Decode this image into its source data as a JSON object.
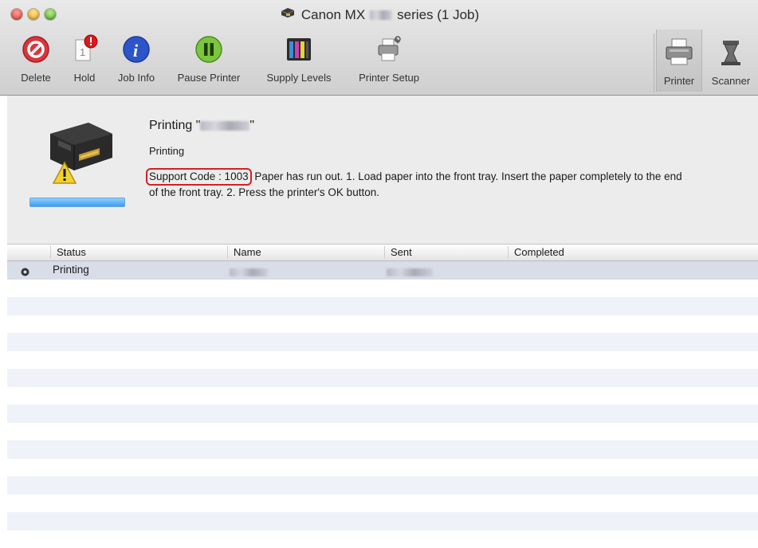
{
  "window": {
    "title_prefix": "Canon MX",
    "title_suffix": "series (1 Job)",
    "colors": {
      "close": "#e0443b",
      "minimize": "#e8a626",
      "zoom": "#52ae2e"
    }
  },
  "toolbar": {
    "items": [
      {
        "label": "Delete",
        "icon": "delete-icon"
      },
      {
        "label": "Hold",
        "icon": "hold-icon"
      },
      {
        "label": "Job Info",
        "icon": "info-icon"
      },
      {
        "label": "Pause Printer",
        "icon": "pause-icon"
      },
      {
        "label": "Supply Levels",
        "icon": "supply-levels-icon"
      },
      {
        "label": "Printer Setup",
        "icon": "printer-setup-icon"
      }
    ],
    "right_items": [
      {
        "label": "Printer",
        "icon": "printer-icon",
        "active": true
      },
      {
        "label": "Scanner",
        "icon": "scanner-icon",
        "active": false
      }
    ]
  },
  "status": {
    "title_prefix": "Printing \"",
    "title_suffix": "\"",
    "state": "Printing",
    "support_code": "Support Code : 1003",
    "message": "Paper has run out. 1. Load paper into the front tray. Insert the paper completely to the end of the front tray. 2. Press the printer's OK button.",
    "progress_color": "#3d9cf0"
  },
  "table": {
    "columns": [
      "Status",
      "Name",
      "Sent",
      "Completed"
    ],
    "rows": [
      {
        "status": "Printing"
      }
    ]
  }
}
